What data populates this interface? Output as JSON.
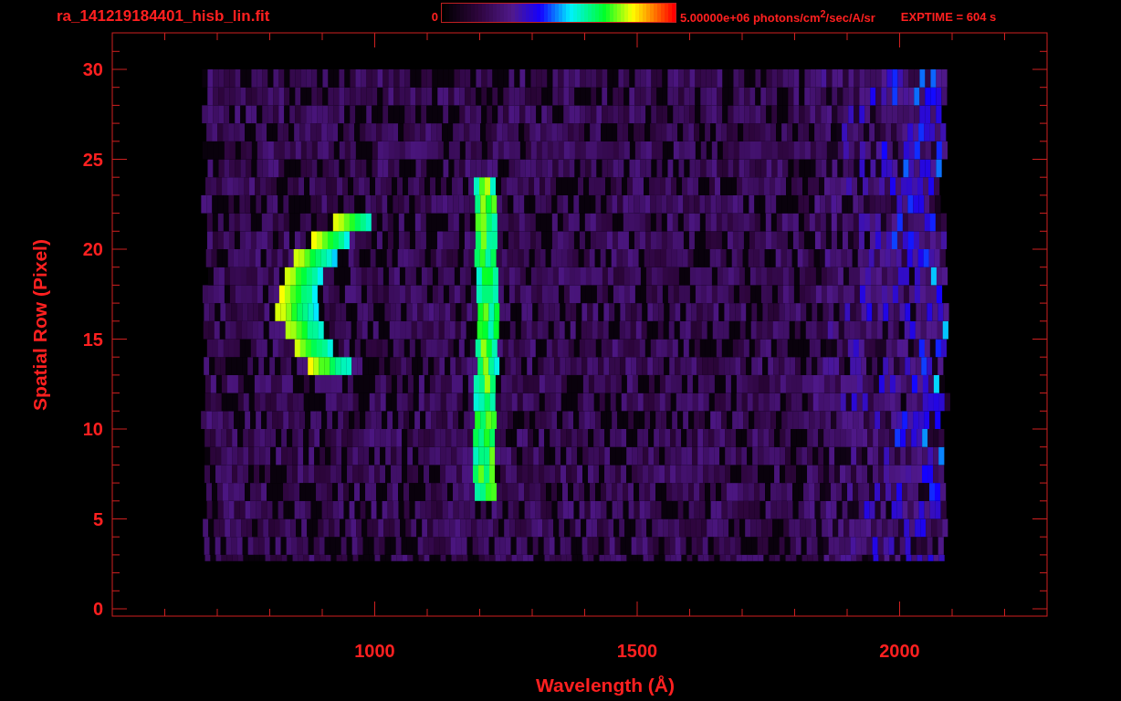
{
  "title": "ra_141219184401_hisb_lin.fit",
  "colorbar": {
    "min_label": "0",
    "max_label": "5.00000e+06 photons/cm$^{2}$/sec/A/sr"
  },
  "exposure": "EXPTIME = 604 s",
  "y_axis": {
    "title": "Spatial Row (Pixel)",
    "ticks": [
      "30",
      "25",
      "20",
      "15",
      "10",
      "5",
      "0"
    ]
  },
  "x_axis": {
    "title": "Wavelength (Å)",
    "ticks": [
      "1000",
      "1500",
      "2000"
    ]
  }
}
